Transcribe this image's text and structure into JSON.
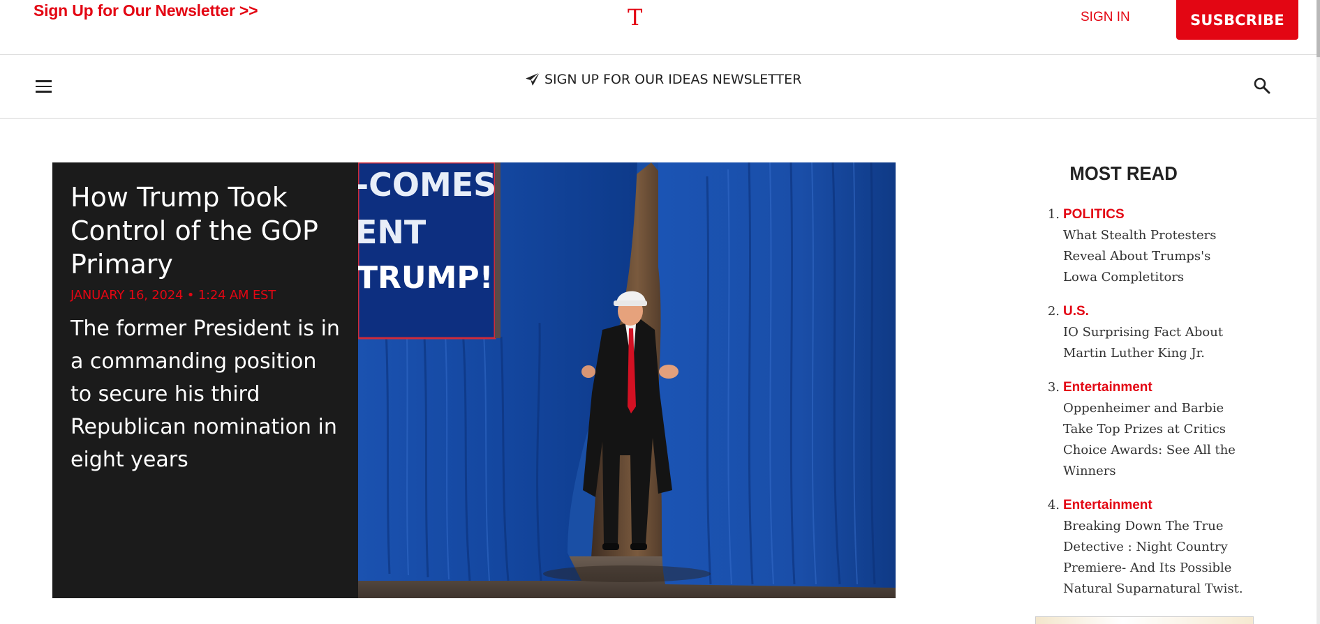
{
  "header": {
    "newsletter_link": "Sign Up for Our Newsletter >>",
    "logo_letter": "T",
    "sign_in": "SIGN IN",
    "subscribe": "SUSBCRIBE"
  },
  "nav": {
    "menu_icon": "hamburger-menu-icon",
    "ideas_icon": "paper-plane-icon",
    "ideas_newsletter": "SIGN UP FOR OUR IDEAS NEWSLETTER",
    "search_icon": "search-icon"
  },
  "hero": {
    "title": "How Trump Took Control of the GOP Primary",
    "date": "JANUARY 16, 2024 • 1:24 AM EST",
    "dek": "The former President is in a commanding position to secure his third Republican nomination in eight years",
    "photo_sign_lines": [
      "-COMES",
      "ENT",
      "TRUMP!"
    ]
  },
  "most_read": {
    "heading": "MOST READ",
    "items": [
      {
        "number": "1.",
        "category": "POLITICS",
        "title": "What Stealth Protesters Reveal About Trumps's Lowa Completitors"
      },
      {
        "number": "2.",
        "category": "U.S.",
        "title": "IO Surprising Fact About Martin Luther King Jr."
      },
      {
        "number": "3.",
        "category": "Entertainment",
        "title": "Oppenheimer and Barbie Take Top Prizes at Critics Choice Awards: See All the Winners"
      },
      {
        "number": "4.",
        "category": "Entertainment",
        "title": "Breaking Down The True Detective : Night Country Premiere- And Its Possible Natural Suparnatural Twist."
      }
    ]
  },
  "colors": {
    "accent_red": "#e30613",
    "hero_panel": "#1b1b1b",
    "curtain_blue": "#1a4fa5"
  }
}
